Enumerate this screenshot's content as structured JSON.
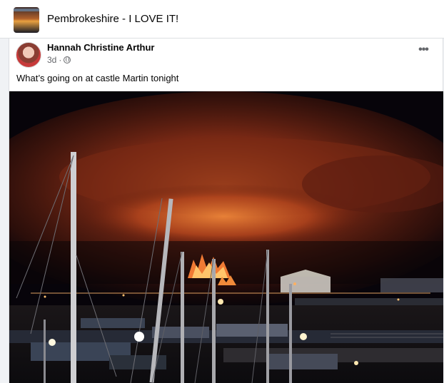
{
  "group": {
    "title": "Pembrokeshire - I LOVE IT!"
  },
  "post": {
    "author": "Hannah Christine Arthur",
    "time": "3d",
    "separator": "·",
    "privacy_icon": "globe-icon",
    "more_label": "•••",
    "text": "What’s going on at castle Martin  tonight"
  },
  "colors": {
    "card": "#ffffff",
    "feed_bg": "#f0f2f5",
    "secondary_text": "#65676b",
    "fire_orange": "#e0602a"
  }
}
